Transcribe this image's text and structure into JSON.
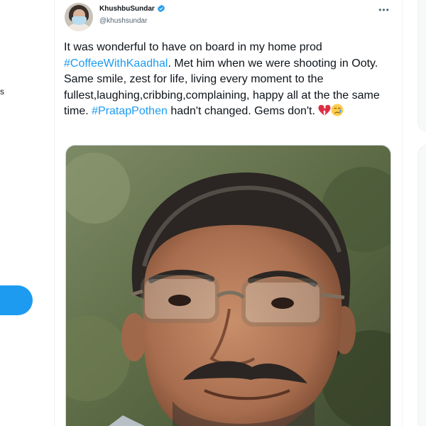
{
  "sidebar": {
    "cropped_glyph": "s",
    "tweet_button_color": "#1d9bf0"
  },
  "tweet": {
    "author": {
      "display_name": "KhushbuSundar",
      "handle": "@khushsundar",
      "verified": true,
      "avatar_icon": "user-avatar"
    },
    "more_icon": "more-options-icon",
    "text": {
      "part1": "It was wonderful to have on board in my home prod ",
      "hashtag1": "#CoffeeWithKaadhal",
      "part2": ". Met him when we were shooting in Ooty. Same smile, zest for life, living every moment to the fullest,laughing,cribbing,complaining, happy all at the the same time. ",
      "hashtag2": "#PratapPothen",
      "part3": " hadn't changed. Gems don't. "
    },
    "emojis": [
      "broken-heart-icon",
      "sad-face-icon"
    ],
    "media": {
      "type": "photo",
      "subject": "man-with-glasses-photo"
    }
  },
  "colors": {
    "accent": "#1d9bf0",
    "text_primary": "#0f1419",
    "text_secondary": "#536471"
  }
}
